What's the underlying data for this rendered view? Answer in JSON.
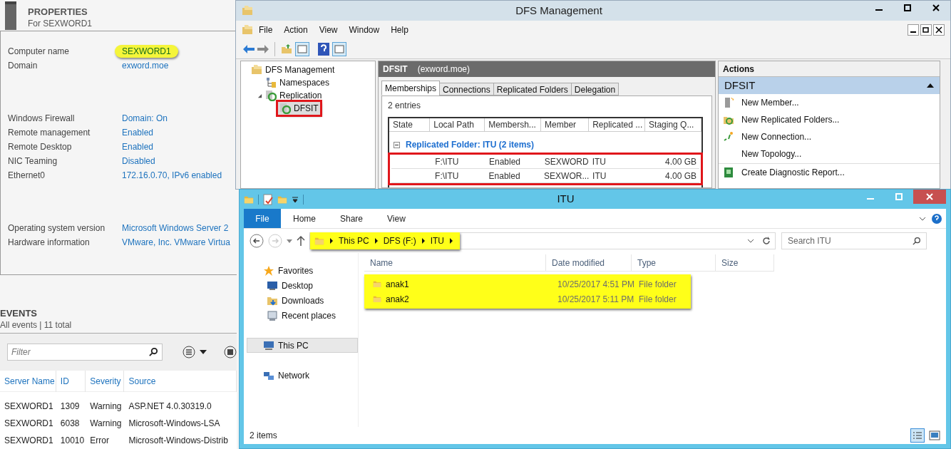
{
  "server_properties": {
    "title": "PROPERTIES",
    "subtitle": "For SEXWORD1",
    "groups": [
      [
        {
          "label": "Computer name",
          "value": "SEXWORD1",
          "highlighted": true
        },
        {
          "label": "Domain",
          "value": "exword.moe",
          "highlighted": false
        }
      ],
      [
        {
          "label": "Windows Firewall",
          "value": "Domain: On",
          "highlighted": false
        },
        {
          "label": "Remote management",
          "value": "Enabled",
          "highlighted": false
        },
        {
          "label": "Remote Desktop",
          "value": "Enabled",
          "highlighted": false
        },
        {
          "label": "NIC Teaming",
          "value": "Disabled",
          "highlighted": false
        },
        {
          "label": "Ethernet0",
          "value": "172.16.0.70, IPv6 enabled",
          "highlighted": false
        }
      ],
      [
        {
          "label": "Operating system version",
          "value": "Microsoft Windows Server 2",
          "highlighted": false
        },
        {
          "label": "Hardware information",
          "value": "VMware, Inc. VMware Virtua",
          "highlighted": false
        }
      ]
    ]
  },
  "events": {
    "title": "EVENTS",
    "summary": "All events | 11 total",
    "filter": {
      "placeholder": "Filter"
    },
    "columns": [
      "Server Name",
      "ID",
      "Severity",
      "Source"
    ],
    "rows": [
      [
        "SEXWORD1",
        "1309",
        "Warning",
        "ASP.NET 4.0.30319.0"
      ],
      [
        "SEXWORD1",
        "6038",
        "Warning",
        "Microsoft-Windows-LSA"
      ],
      [
        "SEXWORD1",
        "10010",
        "Error",
        "Microsoft-Windows-Distrib"
      ]
    ]
  },
  "dfs_window": {
    "title": "DFS Management",
    "menu": [
      "File",
      "Action",
      "View",
      "Window",
      "Help"
    ],
    "tree": [
      {
        "label": "DFS Management",
        "kind": "root",
        "children": [
          {
            "label": "Namespaces",
            "kind": "namespaces",
            "selected": false
          },
          {
            "label": "Replication",
            "kind": "replication",
            "expanded": true,
            "selected": false,
            "children": [
              {
                "label": "DFSIT",
                "kind": "group",
                "selected": true
              }
            ]
          }
        ],
        "selected": false
      }
    ],
    "content": {
      "title": "DFSIT",
      "domain": "(exword.moe)",
      "tabs": [
        {
          "label": "Memberships",
          "selected": true
        },
        {
          "label": "Connections",
          "selected": false
        },
        {
          "label": "Replicated Folders",
          "selected": false
        },
        {
          "label": "Delegation",
          "selected": false
        }
      ],
      "count": "2 entries",
      "columns": [
        "State",
        "Local Path",
        "Membersh...",
        "Member",
        "Replicated ...",
        "Staging Q..."
      ],
      "group": {
        "label": "Replicated Folder: ITU (2 items)",
        "expanded": true
      },
      "rows": [
        {
          "local_path": "F:\\ITU",
          "membership": "Enabled",
          "member": "SEXWORD",
          "replicated": "ITU",
          "staging": "4.00 GB"
        },
        {
          "local_path": "F:\\ITU",
          "membership": "Enabled",
          "member": "SEXWOR...",
          "replicated": "ITU",
          "staging": "4.00 GB"
        }
      ],
      "rows_highlighted": true
    },
    "actions": {
      "title": "Actions",
      "section": {
        "label": "DFSIT",
        "expanded": true
      },
      "items": [
        {
          "label": "New Member...",
          "kind": "member",
          "separator_above": false
        },
        {
          "label": "New Replicated Folders...",
          "kind": "folders",
          "separator_above": false
        },
        {
          "label": "New Connection...",
          "kind": "connection",
          "separator_above": false
        },
        {
          "label": "New Topology...",
          "kind": "plain",
          "separator_above": false
        },
        {
          "label": "Create Diagnostic Report...",
          "kind": "report",
          "separator_above": true
        }
      ]
    }
  },
  "explorer": {
    "title": "ITU",
    "ribbon_tabs": [
      {
        "label": "File",
        "kind": "file"
      },
      {
        "label": "Home",
        "kind": "tab"
      },
      {
        "label": "Share",
        "kind": "tab"
      },
      {
        "label": "View",
        "kind": "tab"
      }
    ],
    "address": {
      "crumbs": [
        "This PC",
        "DFS (F:)",
        "ITU"
      ],
      "highlighted": true
    },
    "search": {
      "placeholder": "Search ITU"
    },
    "nav": [
      {
        "label": "Favorites",
        "kind": "favorites",
        "selected": false,
        "children": [
          {
            "label": "Desktop",
            "kind": "desktop",
            "selected": false
          },
          {
            "label": "Downloads",
            "kind": "downloads",
            "selected": false
          },
          {
            "label": "Recent places",
            "kind": "recent",
            "selected": false
          }
        ]
      },
      {
        "label": "This PC",
        "kind": "pc",
        "selected": true
      },
      {
        "label": "Network",
        "kind": "network",
        "selected": false
      }
    ],
    "columns": [
      "Name",
      "Date modified",
      "Type",
      "Size"
    ],
    "files": [
      {
        "name": "anak1",
        "modified": "10/25/2017 4:51 PM",
        "type": "File folder"
      },
      {
        "name": "anak2",
        "modified": "10/25/2017 5:11 PM",
        "type": "File folder"
      }
    ],
    "files_highlighted": true,
    "status": "2 items"
  }
}
